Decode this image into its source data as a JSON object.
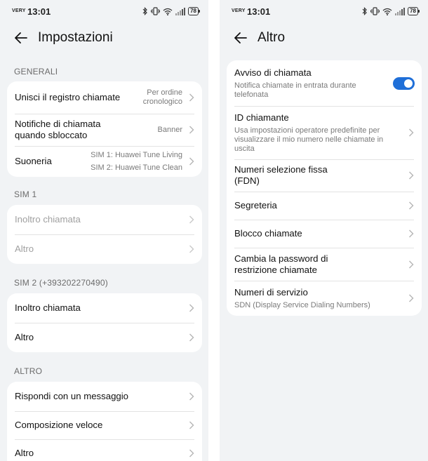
{
  "status": {
    "carrier": "VERY",
    "time": "13:01",
    "battery": "78"
  },
  "left": {
    "title": "Impostazioni",
    "sections": {
      "generali": "GENERALI",
      "sim1": "SIM 1",
      "sim2": "SIM 2 (+393202270490)",
      "altro": "ALTRO"
    },
    "generali_rows": {
      "registro": {
        "title": "Unisci il registro chiamate",
        "value_line1": "Per ordine",
        "value_line2": "cronologico"
      },
      "notifiche": {
        "title_line1": "Notifiche di chiamata",
        "title_line2": "quando sbloccato",
        "value": "Banner"
      },
      "suoneria": {
        "title": "Suoneria",
        "value_line1": "SIM 1: Huawei Tune Living",
        "value_line2": "SIM 2: Huawei Tune Clean"
      }
    },
    "sim1_rows": {
      "inoltro": "Inoltro chiamata",
      "altro": "Altro"
    },
    "sim2_rows": {
      "inoltro": "Inoltro chiamata",
      "altro": "Altro"
    },
    "altro_rows": {
      "rispondi": "Rispondi con un messaggio",
      "composizione": "Composizione veloce",
      "altro": "Altro"
    }
  },
  "right": {
    "title": "Altro",
    "rows": {
      "avviso": {
        "title": "Avviso di chiamata",
        "sub_line1": "Notifica chiamate in entrata durante",
        "sub_line2": "telefonata",
        "toggle_on": true
      },
      "id": {
        "title": "ID chiamante",
        "sub_line1": "Usa impostazioni operatore predefinite per",
        "sub_line2": "visualizzare il mio numero nelle chiamate in",
        "sub_line3": "uscita"
      },
      "fdn": {
        "title_line1": "Numeri selezione fissa",
        "title_line2": "(FDN)"
      },
      "segreteria": {
        "title": "Segreteria"
      },
      "blocco": {
        "title": "Blocco chiamate"
      },
      "password": {
        "title_line1": "Cambia la password di",
        "title_line2": "restrizione chiamate"
      },
      "servizio": {
        "title": "Numeri di servizio",
        "sub": "SDN (Display Service Dialing Numbers)"
      }
    }
  },
  "colors": {
    "accent": "#1f6fd8",
    "background": "#f1f3f5",
    "card": "#ffffff"
  }
}
